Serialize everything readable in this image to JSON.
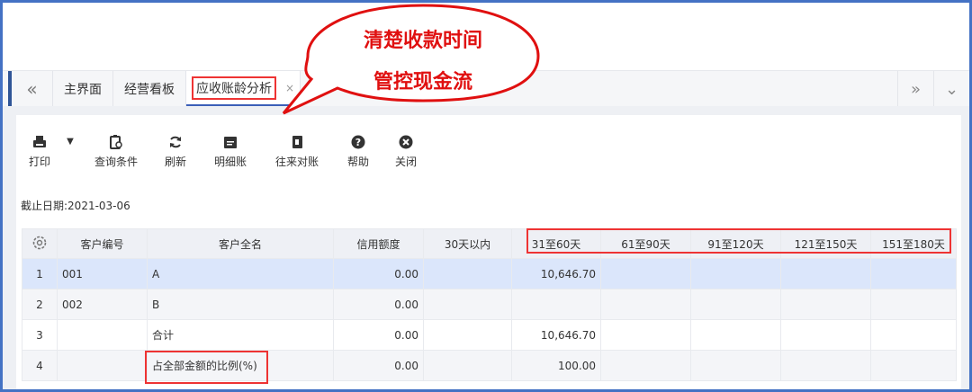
{
  "callout": {
    "line1": "清楚收款时间",
    "line2": "管控现金流"
  },
  "tabs": {
    "prev": "«",
    "items": [
      {
        "label": "主界面"
      },
      {
        "label": "经营看板"
      },
      {
        "label": "应收账龄分析",
        "active": true
      }
    ],
    "close": "×",
    "next": "»",
    "more": "⌄"
  },
  "toolbar": [
    {
      "label": "打印",
      "icon": "printer-icon"
    },
    {
      "label": "查询条件",
      "icon": "query-icon"
    },
    {
      "label": "刷新",
      "icon": "refresh-icon"
    },
    {
      "label": "明细账",
      "icon": "ledger-icon"
    },
    {
      "label": "往来对账",
      "icon": "reconcile-icon"
    },
    {
      "label": "帮助",
      "icon": "help-icon"
    },
    {
      "label": "关闭",
      "icon": "close-icon"
    }
  ],
  "date_label": "截止日期:2021-03-06",
  "table": {
    "headers": [
      "客户编号",
      "客户全名",
      "信用额度",
      "30天以内",
      "31至60天",
      "61至90天",
      "91至120天",
      "121至150天",
      "151至180天"
    ],
    "rows": [
      [
        "1",
        "001",
        "A",
        "0.00",
        "",
        "10,646.70",
        "",
        "",
        "",
        ""
      ],
      [
        "2",
        "002",
        "B",
        "0.00",
        "",
        "",
        "",
        "",
        "",
        ""
      ],
      [
        "3",
        "",
        "合计",
        "0.00",
        "",
        "10,646.70",
        "",
        "",
        "",
        ""
      ],
      [
        "4",
        "",
        "占全部金额的比例(%)",
        "0.00",
        "",
        "100.00",
        "",
        "",
        "",
        ""
      ]
    ]
  },
  "colors": {
    "accent": "#3b5fb8",
    "highlight": "#e33333",
    "frame": "#4472c4",
    "selected_row": "#dbe6fb"
  }
}
